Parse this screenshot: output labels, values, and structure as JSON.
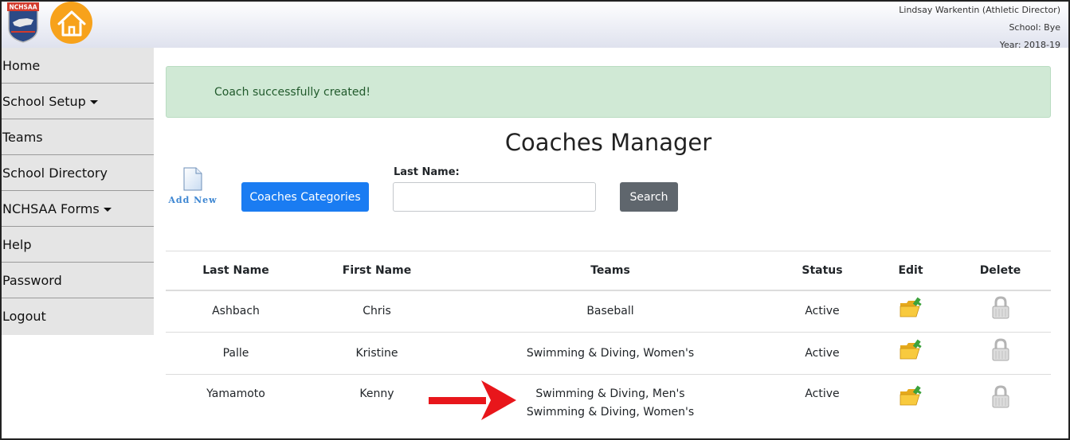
{
  "header": {
    "user_name": "Lindsay Warkentin (Athletic Director)",
    "school": "School: Bye",
    "year": "Year: 2018-19",
    "logo_text": "NCHSAA"
  },
  "sidebar": {
    "items": [
      {
        "label": "Home",
        "dropdown": false
      },
      {
        "label": "School Setup",
        "dropdown": true
      },
      {
        "label": "Teams",
        "dropdown": false
      },
      {
        "label": "School Directory",
        "dropdown": false
      },
      {
        "label": "NCHSAA Forms",
        "dropdown": true
      },
      {
        "label": "Help",
        "dropdown": false
      },
      {
        "label": "Password",
        "dropdown": false
      },
      {
        "label": "Logout",
        "dropdown": false
      }
    ]
  },
  "alert": {
    "message": "Coach successfully created!"
  },
  "page_title": "Coaches Manager",
  "toolbar": {
    "add_new_label": "Add New",
    "categories_label": "Coaches Categories",
    "last_name_label": "Last Name:",
    "last_name_value": "",
    "search_label": "Search"
  },
  "table": {
    "headers": [
      "Last Name",
      "First Name",
      "Teams",
      "Status",
      "Edit",
      "Delete"
    ],
    "rows": [
      {
        "last": "Ashbach",
        "first": "Chris",
        "teams": [
          "Baseball"
        ],
        "status": "Active"
      },
      {
        "last": "Palle",
        "first": "Kristine",
        "teams": [
          "Swimming & Diving, Women's"
        ],
        "status": "Active"
      },
      {
        "last": "Yamamoto",
        "first": "Kenny",
        "teams": [
          "Swimming & Diving, Men's",
          "Swimming & Diving, Women's"
        ],
        "status": "Active"
      }
    ]
  },
  "colors": {
    "accent_blue": "#1a7cf2",
    "home_orange": "#f7a21b",
    "alert_bg": "#d0e9d5",
    "arrow_red": "#e8161b"
  },
  "icons": {
    "edit": "folder-edit-icon",
    "delete": "lock-icon",
    "add_new": "document-icon",
    "home": "home-icon"
  }
}
